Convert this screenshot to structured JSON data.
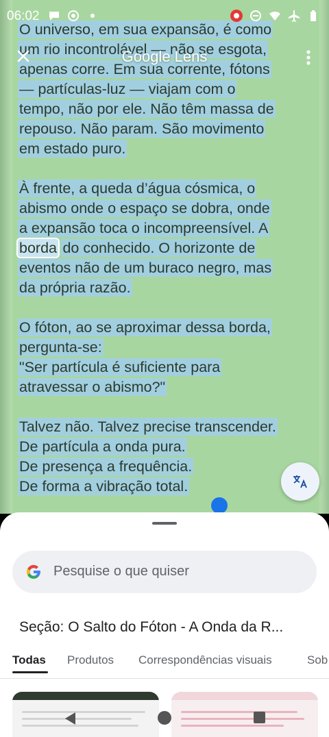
{
  "status_bar": {
    "time": "06:02"
  },
  "lens": {
    "title": "Google Lens"
  },
  "scanned_text": {
    "paragraphs": [
      [
        "O universo, em sua expansão, é como",
        "um rio incontrolável — não se esgota,",
        "apenas corre. Em sua corrente, fótons",
        "— partículas-luz — viajam com o",
        "tempo, não por ele. Não têm massa de",
        "repouso. Não param. São movimento",
        "em estado puro."
      ],
      [
        "À frente, a queda d’água cósmica, o",
        "abismo onde o espaço se dobra, onde",
        "a expansão toca o incompreensível. A",
        "",
        "eventos não de um buraco negro, mas",
        "da própria razão."
      ],
      [
        "O fóton, ao se aproximar dessa borda,",
        "pergunta-se:",
        "\"Ser partícula é suficiente para",
        "atravessar o abismo?\""
      ],
      [
        "Talvez não. Talvez precise transcender.",
        "De partícula a onda pura.",
        "De presença a frequência.",
        "De forma a vibração total."
      ]
    ],
    "selected_word": "borda",
    "after_selected": "do conhecido. O horizonte de"
  },
  "sheet": {
    "search_placeholder": "Pesquise o que quiser",
    "section_title": "Seção: O Salto do Fóton - A Onda da R...",
    "tabs": [
      "Todas",
      "Produtos",
      "Correspondências visuais",
      "Sob"
    ]
  }
}
